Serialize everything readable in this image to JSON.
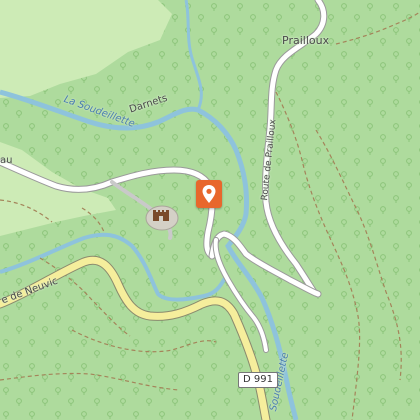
{
  "map": {
    "labels": {
      "hamlet": "Prailloux",
      "locality": "Darnets",
      "river_main": "La Soudeillette",
      "road_prailloux": "Route de Prailloux",
      "road_neuvic": "e de Neuvic",
      "road_partial_left": "au",
      "river_lower": "Soudeillette"
    },
    "road_shield": "D 991",
    "marker": {
      "icon": "location-pin-icon",
      "color": "#e8672c"
    },
    "poi": {
      "icon": "castle-icon"
    }
  }
}
